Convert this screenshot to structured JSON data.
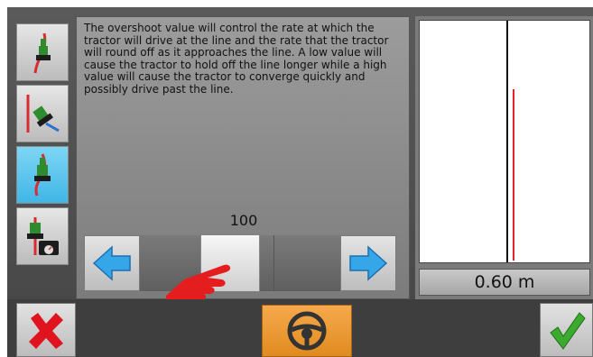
{
  "panel": {
    "description": "The overshoot value will control the rate at which the tractor will drive at the line and the rate that the tractor will round off as it approaches the line. A low value will cause the tractor to hold off the line longer while a high value will cause the tractor to converge quickly and possibly drive past the line.",
    "value": "100",
    "slider_position": 0.45
  },
  "graph": {
    "readout": "0.60 m"
  },
  "sidebar": {
    "items": [
      {
        "icon": "tractor-line-icon"
      },
      {
        "icon": "tractor-turn-icon"
      },
      {
        "icon": "tractor-overshoot-icon",
        "active": true
      },
      {
        "icon": "tractor-speed-icon"
      }
    ]
  },
  "colors": {
    "accent_blue": "#3fb6e6",
    "guide_red": "#e8222a",
    "steer_orange": "#f09a30",
    "confirm_green": "#3caa2e",
    "cancel_red": "#e0141e"
  },
  "icons": {
    "left_arrow": "arrow-left-icon",
    "right_arrow": "arrow-right-icon",
    "cancel": "cancel-x-icon",
    "steer": "steering-wheel-icon",
    "confirm": "checkmark-icon",
    "hand": "pointing-hand-icon"
  }
}
